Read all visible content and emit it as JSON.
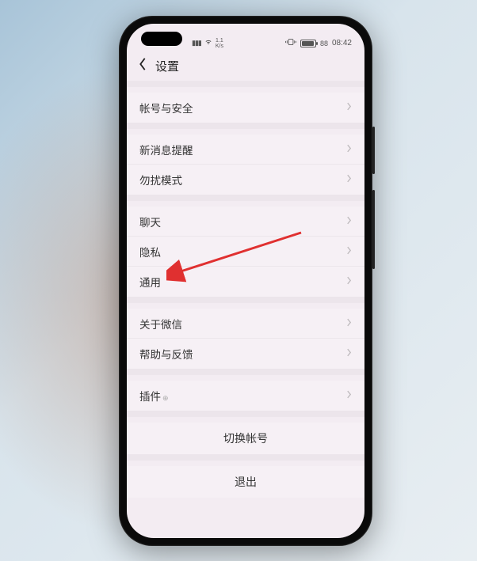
{
  "status": {
    "signal_kbs_top": "1.1",
    "signal_kbs_bottom": "K/s",
    "battery_pct": "88",
    "time": "08:42"
  },
  "header": {
    "title": "设置"
  },
  "groups": [
    {
      "items": [
        {
          "label": "帐号与安全"
        }
      ]
    },
    {
      "items": [
        {
          "label": "新消息提醒"
        },
        {
          "label": "勿扰模式"
        }
      ]
    },
    {
      "items": [
        {
          "label": "聊天"
        },
        {
          "label": "隐私"
        },
        {
          "label": "通用"
        }
      ]
    },
    {
      "items": [
        {
          "label": "关于微信"
        },
        {
          "label": "帮助与反馈"
        }
      ]
    },
    {
      "items": [
        {
          "label": "插件",
          "badge": true
        }
      ]
    }
  ],
  "actions": {
    "switch_account": "切换帐号",
    "logout": "退出"
  },
  "annotation": {
    "arrow_target": "通用"
  }
}
